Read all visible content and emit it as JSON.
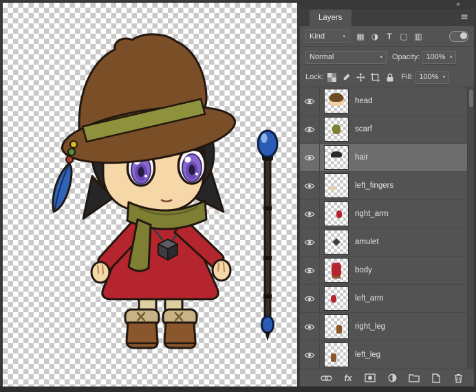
{
  "canvas": {
    "artwork_description": "Chibi witch character with brown hat, purple eyes, red dress, olive scarf, brown boots, and a blue-orb staff"
  },
  "panel": {
    "collapse_icon": "»",
    "menu_icon": "≡",
    "chevron": "▾",
    "title": "Layers",
    "filter": {
      "kind_label": "Kind",
      "icons": {
        "pixel": "▦",
        "adjustment": "◑",
        "type": "T",
        "shape": "▢",
        "smart_object": "▥"
      }
    },
    "blend": {
      "mode": "Normal",
      "opacity_label": "Opacity:",
      "opacity_value": "100%"
    },
    "lock": {
      "label": "Lock:",
      "fill_label": "Fill:",
      "fill_value": "100%"
    },
    "layers": [
      {
        "name": "head",
        "visible": true,
        "selected": false
      },
      {
        "name": "scarf",
        "visible": true,
        "selected": false
      },
      {
        "name": "hair",
        "visible": true,
        "selected": true
      },
      {
        "name": "left_fingers",
        "visible": true,
        "selected": false
      },
      {
        "name": "right_arm",
        "visible": true,
        "selected": false
      },
      {
        "name": "amulet",
        "visible": true,
        "selected": false
      },
      {
        "name": "body",
        "visible": true,
        "selected": false
      },
      {
        "name": "left_arm",
        "visible": true,
        "selected": false
      },
      {
        "name": "right_leg",
        "visible": true,
        "selected": false
      },
      {
        "name": "left_leg",
        "visible": true,
        "selected": false
      }
    ],
    "bottom_bar": {
      "fx_label": "fx"
    }
  },
  "colors": {
    "panel_bg": "#535353",
    "selected_row": "#6d6d6d",
    "row_divider": "#484848",
    "text": "#e2e2e2",
    "dress_red": "#b4252d",
    "staff_blue": "#2b5cb5"
  }
}
